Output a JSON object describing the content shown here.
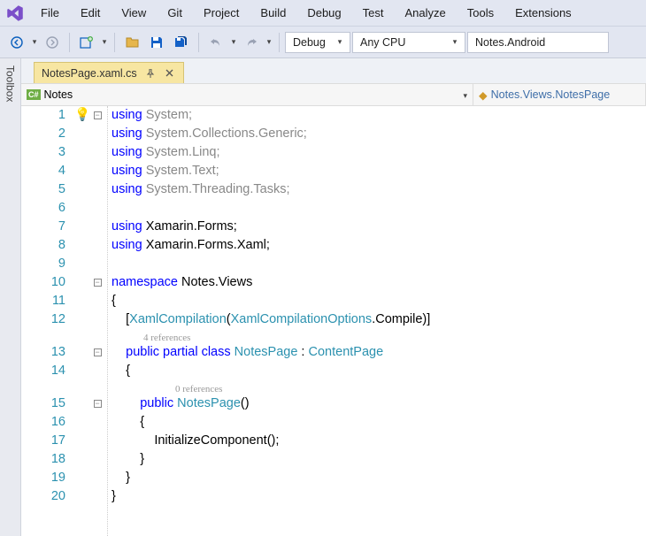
{
  "menubar": {
    "items": [
      "File",
      "Edit",
      "View",
      "Git",
      "Project",
      "Build",
      "Debug",
      "Test",
      "Analyze",
      "Tools",
      "Extensions"
    ]
  },
  "toolbar": {
    "config": "Debug",
    "platform": "Any CPU",
    "target": "Notes.Android"
  },
  "toolbox_label": "Toolbox",
  "doctab": {
    "title": "NotesPage.xaml.cs"
  },
  "navbar": {
    "scope": "Notes",
    "member": "Notes.Views.NotesPage"
  },
  "code": {
    "lines": [
      {
        "n": 1,
        "bulb": true,
        "fold": "-",
        "seg": [
          [
            "kw",
            "using"
          ],
          [
            "",
            " "
          ],
          [
            "fade",
            "System"
          ],
          [
            "fade",
            ";"
          ]
        ]
      },
      {
        "n": 2,
        "seg": [
          [
            "kw",
            "using"
          ],
          [
            "",
            " "
          ],
          [
            "fade",
            "System.Collections.Generic"
          ],
          [
            "fade",
            ";"
          ]
        ]
      },
      {
        "n": 3,
        "seg": [
          [
            "kw",
            "using"
          ],
          [
            "",
            " "
          ],
          [
            "fade",
            "System.Linq"
          ],
          [
            "fade",
            ";"
          ]
        ]
      },
      {
        "n": 4,
        "seg": [
          [
            "kw",
            "using"
          ],
          [
            "",
            " "
          ],
          [
            "fade",
            "System.Text"
          ],
          [
            "fade",
            ";"
          ]
        ]
      },
      {
        "n": 5,
        "seg": [
          [
            "kw",
            "using"
          ],
          [
            "",
            " "
          ],
          [
            "fade",
            "System.Threading.Tasks"
          ],
          [
            "fade",
            ";"
          ]
        ]
      },
      {
        "n": 6,
        "seg": []
      },
      {
        "n": 7,
        "seg": [
          [
            "kw",
            "using"
          ],
          [
            "",
            " Xamarin.Forms;"
          ]
        ]
      },
      {
        "n": 8,
        "seg": [
          [
            "kw",
            "using"
          ],
          [
            "",
            " Xamarin.Forms.Xaml;"
          ]
        ]
      },
      {
        "n": 9,
        "seg": []
      },
      {
        "n": 10,
        "fold": "-",
        "seg": [
          [
            "kw",
            "namespace"
          ],
          [
            "",
            " Notes.Views"
          ]
        ]
      },
      {
        "n": 11,
        "seg": [
          [
            "",
            "{"
          ]
        ]
      },
      {
        "n": 12,
        "seg": [
          [
            "",
            "    ["
          ],
          [
            "type",
            "XamlCompilation"
          ],
          [
            "",
            "("
          ],
          [
            "type",
            "XamlCompilationOptions"
          ],
          [
            "",
            ".Compile)]"
          ]
        ]
      },
      {
        "n": "",
        "ref": "4 references",
        "seg": []
      },
      {
        "n": 13,
        "fold": "-",
        "seg": [
          [
            "",
            "    "
          ],
          [
            "kw",
            "public"
          ],
          [
            "",
            " "
          ],
          [
            "kw",
            "partial"
          ],
          [
            "",
            " "
          ],
          [
            "kw",
            "class"
          ],
          [
            "",
            " "
          ],
          [
            "type",
            "NotesPage"
          ],
          [
            "",
            " : "
          ],
          [
            "type",
            "ContentPage"
          ]
        ]
      },
      {
        "n": 14,
        "seg": [
          [
            "",
            "    {"
          ]
        ]
      },
      {
        "n": "",
        "ref": "0 references",
        "seg": []
      },
      {
        "n": 15,
        "fold": "-",
        "seg": [
          [
            "",
            "        "
          ],
          [
            "kw",
            "public"
          ],
          [
            "",
            " "
          ],
          [
            "type",
            "NotesPage"
          ],
          [
            "",
            "()"
          ]
        ]
      },
      {
        "n": 16,
        "seg": [
          [
            "",
            "        {"
          ]
        ]
      },
      {
        "n": 17,
        "seg": [
          [
            "",
            "            InitializeComponent();"
          ]
        ]
      },
      {
        "n": 18,
        "seg": [
          [
            "",
            "        }"
          ]
        ]
      },
      {
        "n": 19,
        "seg": [
          [
            "",
            "    }"
          ]
        ]
      },
      {
        "n": 20,
        "seg": [
          [
            "",
            "}"
          ]
        ]
      }
    ]
  }
}
